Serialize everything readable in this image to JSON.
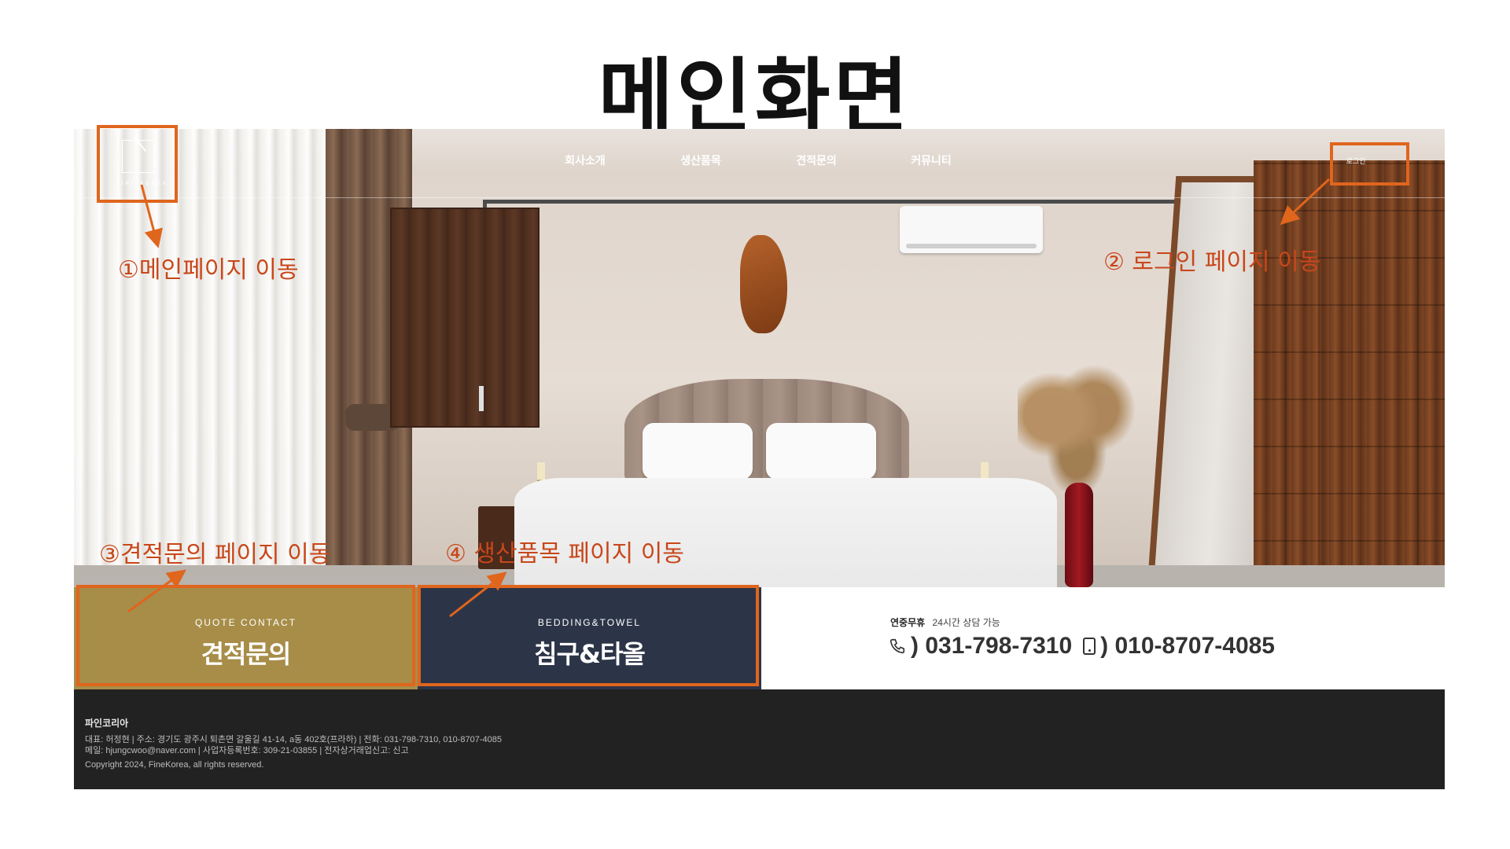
{
  "slide": {
    "title": "메인화면"
  },
  "nav": {
    "logo_text": "FINE KOREA",
    "menu": [
      "회사소개",
      "생산품목",
      "견적문의",
      "커뮤니티"
    ],
    "login": "로그인"
  },
  "cta": {
    "quote": {
      "sub": "QUOTE CONTACT",
      "main": "견적문의"
    },
    "bedding": {
      "sub": "BEDDING&TOWEL",
      "main": "침구&타올"
    }
  },
  "contact": {
    "label": "연중무휴",
    "hours": "24시간 상담 가능",
    "phone": ") 031-798-7310",
    "mobile": ") 010-8707-4085"
  },
  "footer": {
    "company": "파인코리아",
    "line1": "대표: 허정현 | 주소: 경기도 광주시 퇴촌면 갈울길 41-14, a동 402호(프라하) | 전화: 031-798-7310, 010-8707-4085",
    "line2": "메일: hjungcwoo@naver.com | 사업자등록번호: 309-21-03855 | 전자상거래업신고: 신고",
    "copyright": "Copyright 2024, FineKorea, all rights reserved."
  },
  "annotations": {
    "n1": "①메인페이지 이동",
    "n2": "② 로그인 페이지 이동",
    "n3": "③견적문의 페이지 이동",
    "n4": "④ 생산품목 페이지 이동"
  },
  "colors": {
    "highlight": "#e0651d",
    "annotation_text": "#c8471a",
    "quote_bg": "#a78d48",
    "bedding_bg": "#2c3548",
    "footer_bg": "#222222"
  }
}
